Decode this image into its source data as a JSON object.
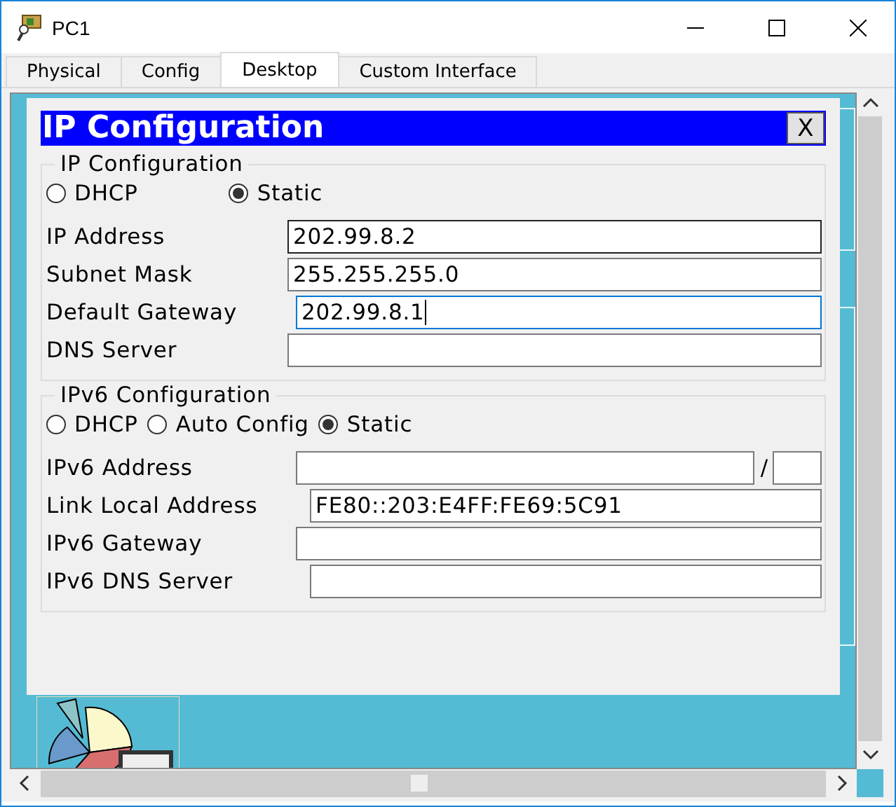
{
  "window": {
    "title": "PC1"
  },
  "tabs": [
    {
      "label": "Physical",
      "selected": false
    },
    {
      "label": "Config",
      "selected": false
    },
    {
      "label": "Desktop",
      "selected": true
    },
    {
      "label": "Custom Interface",
      "selected": false
    }
  ],
  "dialog": {
    "title": "IP Configuration",
    "close": "X",
    "ipv4": {
      "legend": "IP Configuration",
      "modes": [
        {
          "label": "DHCP",
          "selected": false
        },
        {
          "label": "Static",
          "selected": true
        }
      ],
      "fields": [
        {
          "label": "IP Address",
          "value": "202.99.8.2",
          "focused": false
        },
        {
          "label": "Subnet Mask",
          "value": "255.255.255.0",
          "focused": false
        },
        {
          "label": "Default Gateway",
          "value": "202.99.8.1",
          "focused": true
        },
        {
          "label": "DNS Server",
          "focused": false
        }
      ]
    },
    "ipv6": {
      "legend": "IPv6 Configuration",
      "modes": [
        {
          "label": "DHCP",
          "selected": false
        },
        {
          "label": "Auto Config",
          "selected": false
        },
        {
          "label": "Static",
          "selected": true
        }
      ],
      "fields": [
        {
          "label": "IPv6 Address",
          "kind": "prefixed",
          "separator": "/",
          "focused": false
        },
        {
          "label": "Link Local Address",
          "kind": "plain",
          "value": "FE80::203:E4FF:FE69:5C91",
          "focused": false
        },
        {
          "label": "IPv6 Gateway",
          "kind": "plain",
          "focused": false
        },
        {
          "label": "IPv6 DNS Server",
          "kind": "plain",
          "focused": false
        }
      ]
    }
  }
}
